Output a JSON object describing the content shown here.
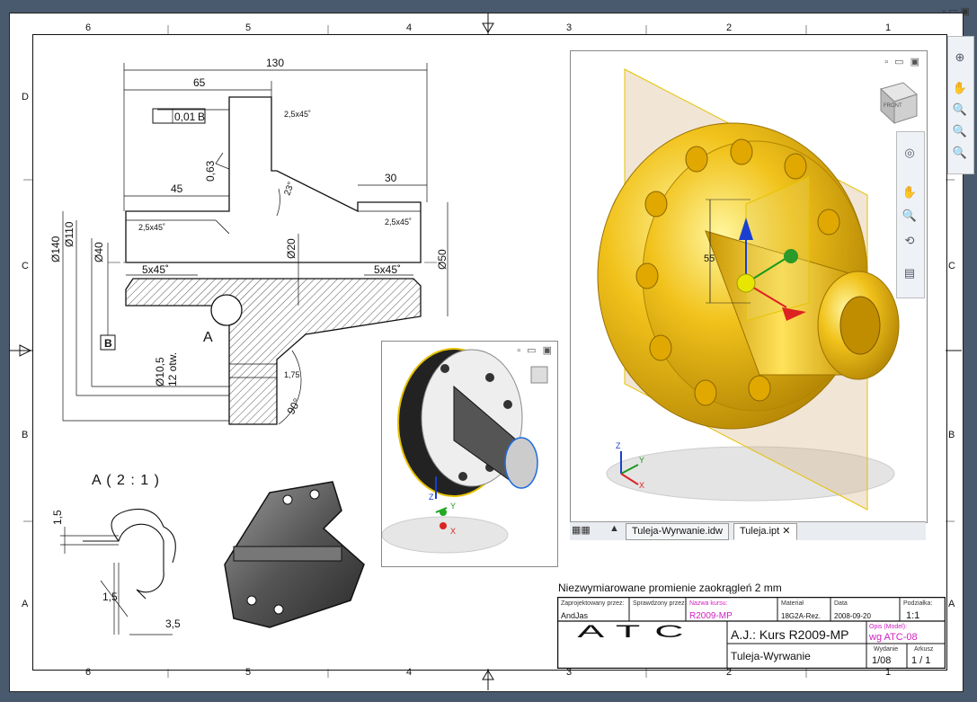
{
  "window_controls": "▫ ▭ ▣",
  "zones": {
    "top": [
      "6",
      "5",
      "4",
      "3",
      "2",
      "1"
    ],
    "side": [
      "D",
      "C",
      "B",
      "A"
    ]
  },
  "drawing": {
    "dims": {
      "d130": "130",
      "d65": "65",
      "d45": "45",
      "d30": "30",
      "tol": "0,01",
      "datum_ref": "B",
      "datum_label": "B",
      "ch1": "2,5x45˚",
      "ch2": "2,5x45˚",
      "ch3": "2,5x45˚",
      "rough": "0,63",
      "angle23": "23°",
      "phi140": "Ø140",
      "phi110": "Ø110",
      "phi40": "Ø40",
      "phi20": "Ø20",
      "phi50": "Ø50",
      "c5a": "5x45˚",
      "c5b": "5x45˚",
      "sectionA": "A",
      "holes1": "Ø10,5",
      "holes2": "12 otw.",
      "d175": "1,75",
      "angle90": "90°"
    },
    "detail": {
      "title": "A ( 2 : 1 )",
      "d15a": "1,5",
      "d15b": "1,5",
      "d35": "3,5"
    },
    "note": "Niezwymiarowane promienie zaokrągleń 2 mm"
  },
  "viewport_small": {
    "axes": [
      "Z",
      "Y",
      "X"
    ]
  },
  "viewport_main": {
    "dim55": "55",
    "axes": [
      "Z",
      "Y",
      "X"
    ],
    "cube_label": "FRONT"
  },
  "tabs": [
    {
      "label": "Tuleja-Wyrwanie.idw"
    },
    {
      "label": "Tuleja.ipt"
    }
  ],
  "title_block": {
    "l_designed": "Zaprojektowany przez:",
    "designed": "AndJas",
    "l_checked": "Sprawdzony przez:",
    "l_course": "Nazwa kursu:",
    "course": "R2009-MP",
    "l_material": "Materiał",
    "material": "18G2A-Rez.",
    "l_date": "Data",
    "date": "2008-09-20",
    "l_scale": "Podziałka:",
    "scale": "1:1",
    "logo": "ATC",
    "title": "A.J.: Kurs R2009-MP",
    "l_model": "Opis (Model):",
    "model": "wg ATC-08",
    "subtitle": "Tuleja-Wyrwanie",
    "l_edition": "Wydanie",
    "edition": "1/08",
    "l_sheet": "Arkusz",
    "sheet": "1 / 1"
  },
  "colors": {
    "bg": "#4a5a6e",
    "gold": "#f1c21b",
    "magenta": "#d020c0"
  }
}
